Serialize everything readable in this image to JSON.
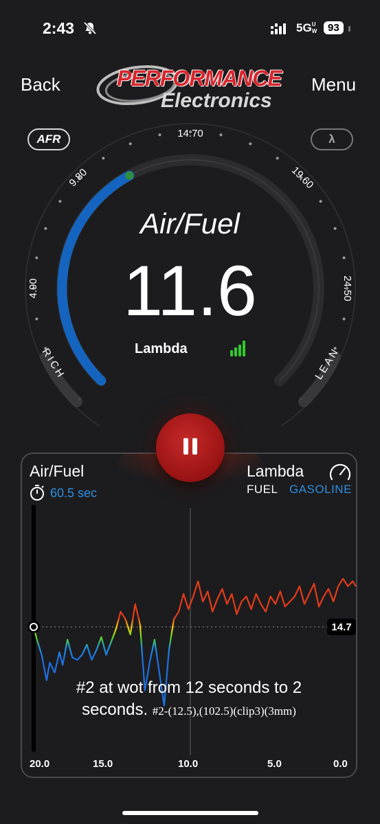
{
  "status_bar": {
    "time": "2:43",
    "network": "5G",
    "network_sup": "UW",
    "battery": "93"
  },
  "nav": {
    "back": "Back",
    "menu": "Menu"
  },
  "logo": {
    "line1": "PERFORMANCE",
    "line2": "Electronics"
  },
  "mode_buttons": {
    "afr": "AFR",
    "lambda": "λ"
  },
  "gauge": {
    "title": "Air/Fuel",
    "value": "11.6",
    "unit_label": "Lambda",
    "ticks": [
      "4.90",
      "9.80",
      "14.70",
      "19.60",
      "24.50"
    ],
    "rich_label": "RICH",
    "lean_label": "LEAN",
    "range": [
      0,
      29.4
    ],
    "arc_color": "#1565c0"
  },
  "panel": {
    "title": "Air/Fuel",
    "timer": "60.5 sec",
    "lambda_label": "Lambda",
    "fuel_label": "FUEL",
    "fuel_value": "GASOLINE",
    "reference_value": "14.7",
    "overlay_line1": "#2 at wot from 12 seconds to 2",
    "overlay_line2": "seconds.",
    "overlay_small": "#2-(12.5),(102.5)(clip3)(3mm)",
    "x_labels": [
      "20.0",
      "15.0",
      "10.0",
      "5.0",
      "0.0"
    ]
  },
  "chart_data": {
    "type": "line",
    "xlabel": "",
    "ylabel": "",
    "x_ticks": [
      "20.0",
      "15.0",
      "10.0",
      "5.0",
      "0.0"
    ],
    "reference_line": 14.7,
    "series": [
      {
        "x": [
          20.0,
          19.8,
          19.5,
          19.2,
          19.0,
          18.7,
          18.4,
          18.2,
          17.9,
          17.6,
          17.3,
          17.0,
          16.7,
          16.4,
          16.1,
          15.8,
          15.5,
          15.2,
          14.9,
          14.6,
          14.3,
          14.0,
          13.7,
          13.4,
          13.1,
          12.8,
          12.5,
          12.2,
          11.9,
          11.6,
          11.3,
          11.0,
          10.7,
          10.4,
          10.1,
          9.8,
          9.5,
          9.2,
          8.9,
          8.6,
          8.3,
          8.0,
          7.7,
          7.4,
          7.1,
          6.8,
          6.5,
          6.2,
          5.9,
          5.6,
          5.3,
          5.0,
          4.7,
          4.4,
          4.1,
          3.8,
          3.5,
          3.2,
          2.9,
          2.6,
          2.3,
          2.0,
          1.7,
          1.4,
          1.1,
          0.8,
          0.5,
          0.2,
          0.0
        ],
        "y": [
          14.7,
          14.2,
          13.6,
          12.6,
          13.3,
          12.9,
          13.7,
          13.2,
          14.2,
          13.5,
          13.4,
          13.6,
          14.0,
          13.4,
          13.8,
          14.3,
          13.6,
          14.1,
          14.6,
          15.3,
          15.0,
          14.4,
          15.6,
          14.8,
          12.2,
          13.3,
          14.2,
          12.9,
          11.6,
          13.8,
          15.0,
          15.3,
          16.0,
          15.4,
          15.9,
          16.5,
          15.7,
          16.1,
          15.3,
          15.8,
          16.2,
          15.6,
          16.0,
          15.2,
          15.7,
          15.9,
          15.4,
          16.0,
          15.6,
          15.3,
          15.9,
          15.6,
          16.1,
          15.5,
          15.7,
          15.9,
          16.3,
          15.6,
          16.0,
          16.4,
          15.5,
          15.9,
          16.2,
          15.7,
          16.3,
          16.6,
          16.3,
          16.5,
          16.3
        ]
      }
    ]
  }
}
